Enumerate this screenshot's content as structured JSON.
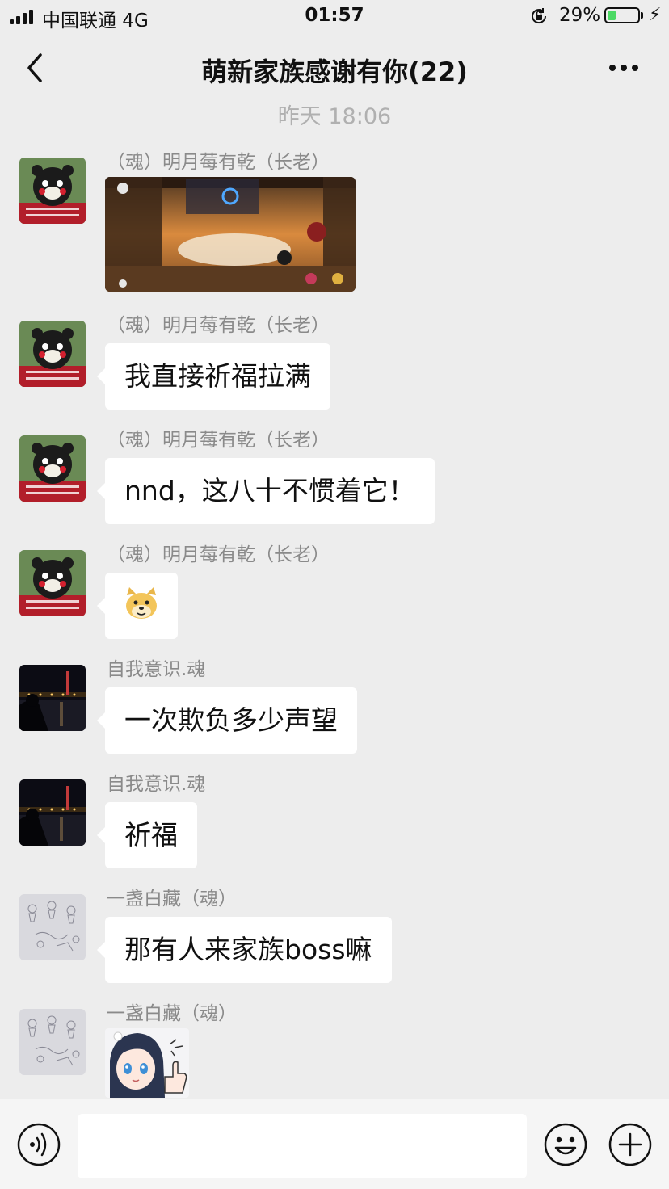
{
  "status_bar": {
    "carrier": "中国联通  4G",
    "time": "01:57",
    "battery_percent": "29%",
    "battery_level": 0.29,
    "battery_color": "#4cd964"
  },
  "nav": {
    "title": "萌新家族感谢有你(22)",
    "back_icon": "chevron-left-icon",
    "more_icon": "more-dots-icon"
  },
  "timestamp": "昨天 18:06",
  "messages": [
    {
      "sender": "（魂）明月莓有乾（长老）",
      "type": "image",
      "content": "game-screenshot"
    },
    {
      "sender": "（魂）明月莓有乾（长老）",
      "type": "text",
      "text": "我直接祈福拉满"
    },
    {
      "sender": "（魂）明月莓有乾（长老）",
      "type": "text",
      "text": "nnd，这八十不惯着它！"
    },
    {
      "sender": "（魂）明月莓有乾（长老）",
      "type": "emoji",
      "content": "doge-emoji"
    },
    {
      "sender": "自我意识.魂",
      "type": "text",
      "text": "一次欺负多少声望"
    },
    {
      "sender": "自我意识.魂",
      "type": "text",
      "text": "祈福"
    },
    {
      "sender": "一盏白藏（魂）",
      "type": "text",
      "text": "那有人来家族boss嘛"
    },
    {
      "sender": "一盏白藏（魂）",
      "type": "sticker",
      "content": "anime-girl-thumbs-up-sticker"
    }
  ],
  "input_bar": {
    "voice_icon": "voice-icon",
    "text_value": "",
    "emoji_icon": "smiley-icon",
    "plus_icon": "plus-circle-icon"
  }
}
